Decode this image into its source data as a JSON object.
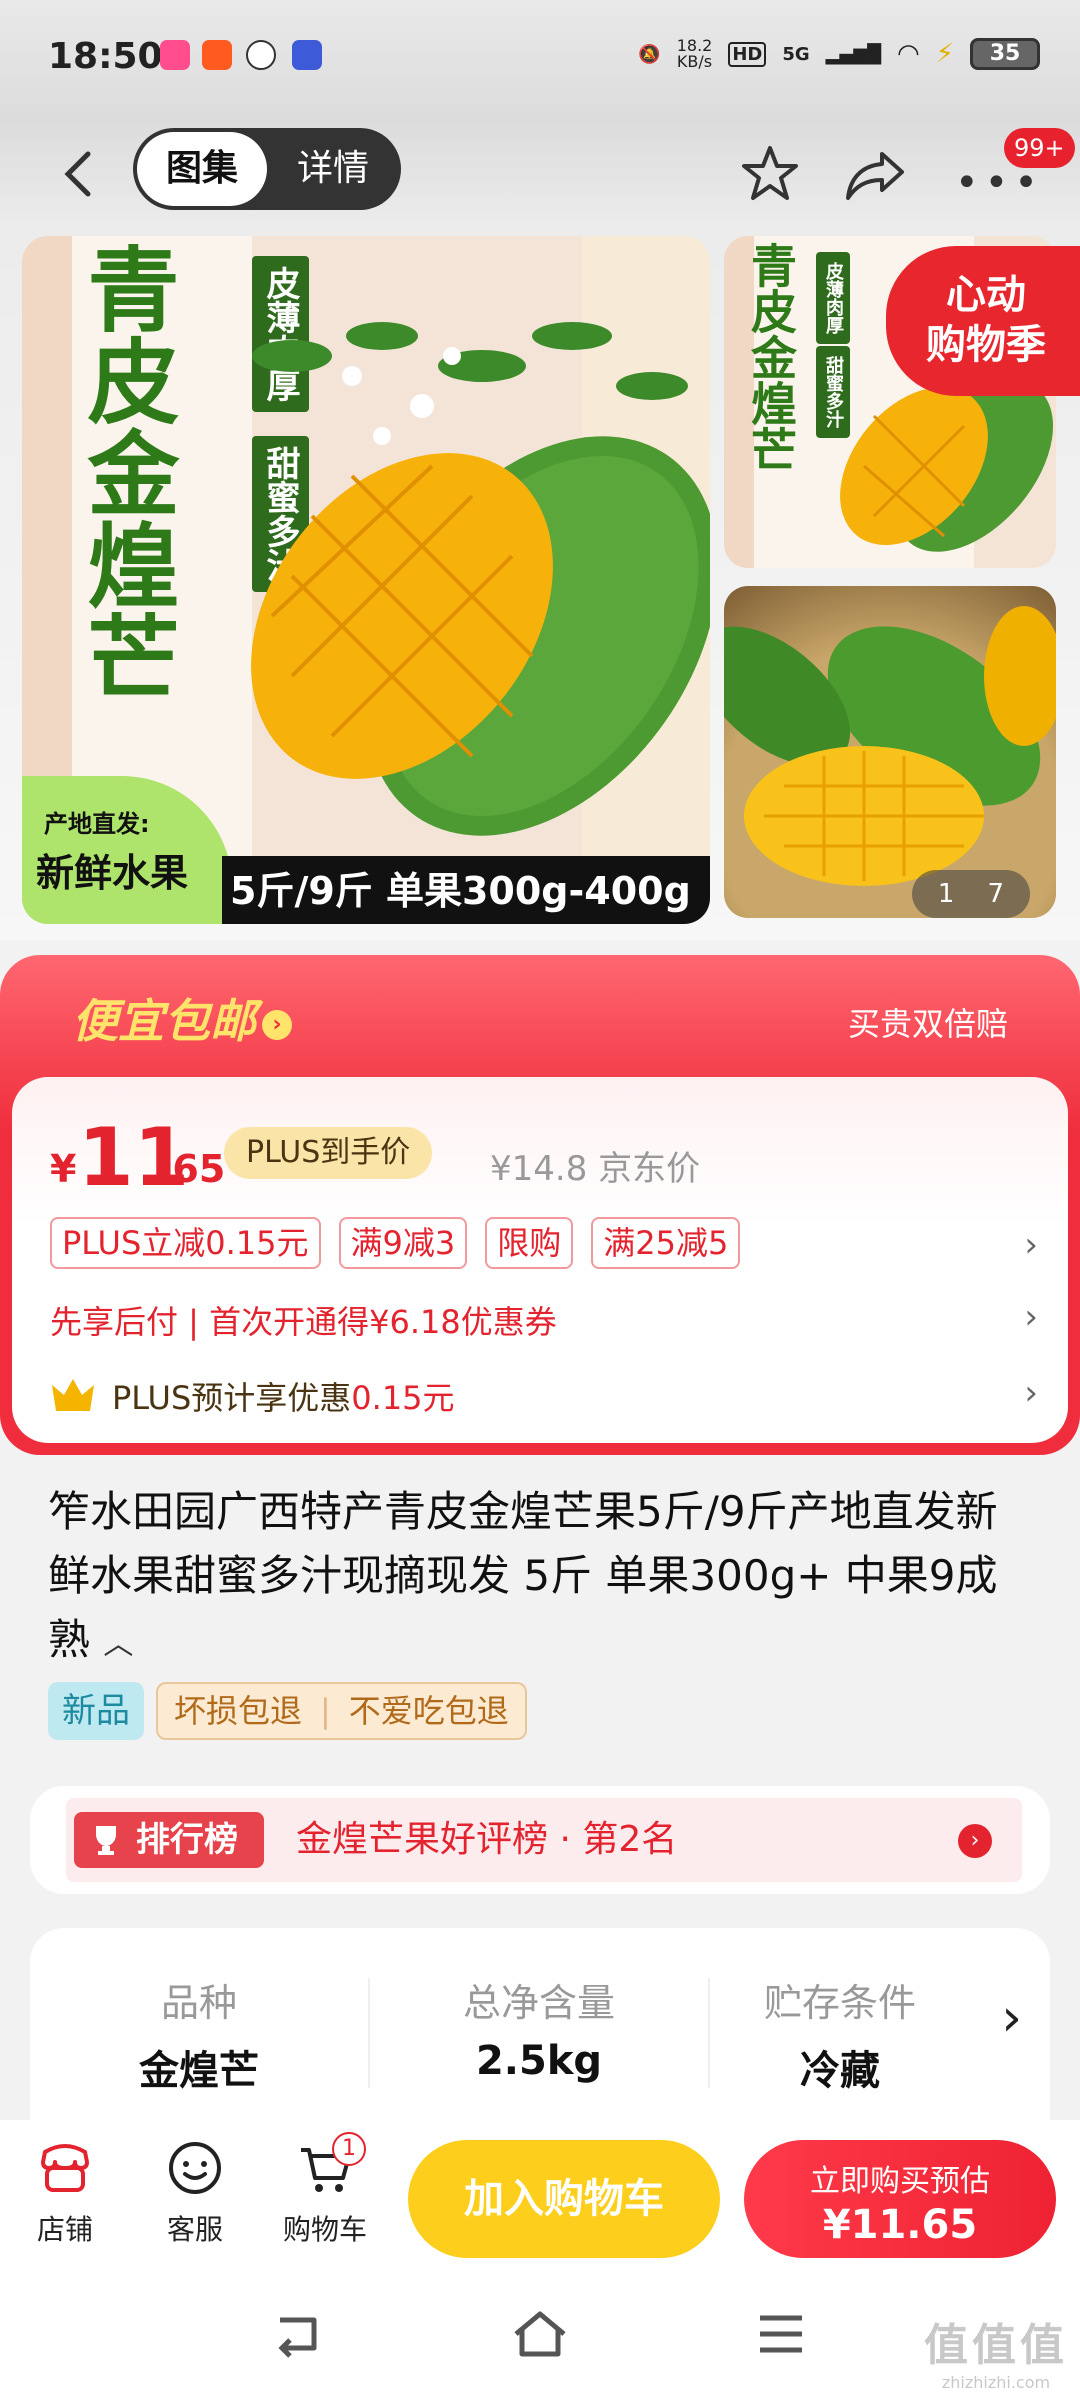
{
  "status_bar": {
    "time": "18:50",
    "net_speed": "18.2\nKB/s",
    "net_speed_top": "18.2",
    "net_speed_bottom": "KB/s",
    "hd": "HD",
    "signal": "5G",
    "battery": "35"
  },
  "header": {
    "tab_gallery": "图集",
    "tab_detail": "详情",
    "message_badge": "99+"
  },
  "gallery": {
    "main_title": "青皮金煌芒",
    "main_sub_1": "皮薄肉厚",
    "main_sub_2": "甜蜜多汁",
    "origin_line1": "产地直发:",
    "origin_line2": "新鲜水果",
    "spec_strip": "5斤/9斤 单果300g-400g",
    "thumb_title": "青皮金煌芒",
    "thumb_sub_1": "皮薄肉厚",
    "thumb_sub_2": "甜蜜多汁",
    "promo_line1": "心动",
    "promo_line2": "购物季",
    "pager_current": "1",
    "pager_total": "7"
  },
  "price": {
    "banner": "便宜包邮",
    "guarantee": "买贵双倍赔",
    "currency": "¥",
    "integer": "11",
    "decimal": ".65",
    "plus_tag": "PLUS到手价",
    "jd_price": "¥14.8 京东价",
    "tags": [
      "PLUS立减0.15元",
      "满9减3",
      "限购",
      "满25减5"
    ],
    "pay_later": "先享后付 | 首次开通得¥6.18优惠券",
    "plus_pre_text": "PLUS预计享优惠",
    "plus_pre_value": "0.15元"
  },
  "product": {
    "title": "笮水田园广西特产青皮金煌芒果5斤/9斤产地直发新鲜水果甜蜜多汁现摘现发 5斤 单果300g+ 中果9成熟",
    "collapse_icon": "chevron-up-icon",
    "badge_new": "新品",
    "badge_damage": "坏损包退",
    "badge_dislike": "不爱吃包退"
  },
  "ranking": {
    "tag": "排行榜",
    "text": "金煌芒果好评榜 · 第2名"
  },
  "specs": [
    {
      "key": "品种",
      "value": "金煌芒"
    },
    {
      "key": "总净含量",
      "value": "2.5kg"
    },
    {
      "key": "贮存条件",
      "value": "冷藏"
    }
  ],
  "bottom_bar": {
    "store": "店铺",
    "service": "客服",
    "cart": "购物车",
    "cart_count": "1",
    "add_to_cart": "加入购物车",
    "buy_now": "立即购买预估",
    "buy_price": "¥11.65"
  },
  "watermark": {
    "line1": "值值值",
    "line2": "zhizhizhi.com"
  },
  "colors": {
    "accent_red": "#ef2d3c",
    "cart_yellow": "#fdcf1c",
    "price_red": "#e3232e"
  }
}
